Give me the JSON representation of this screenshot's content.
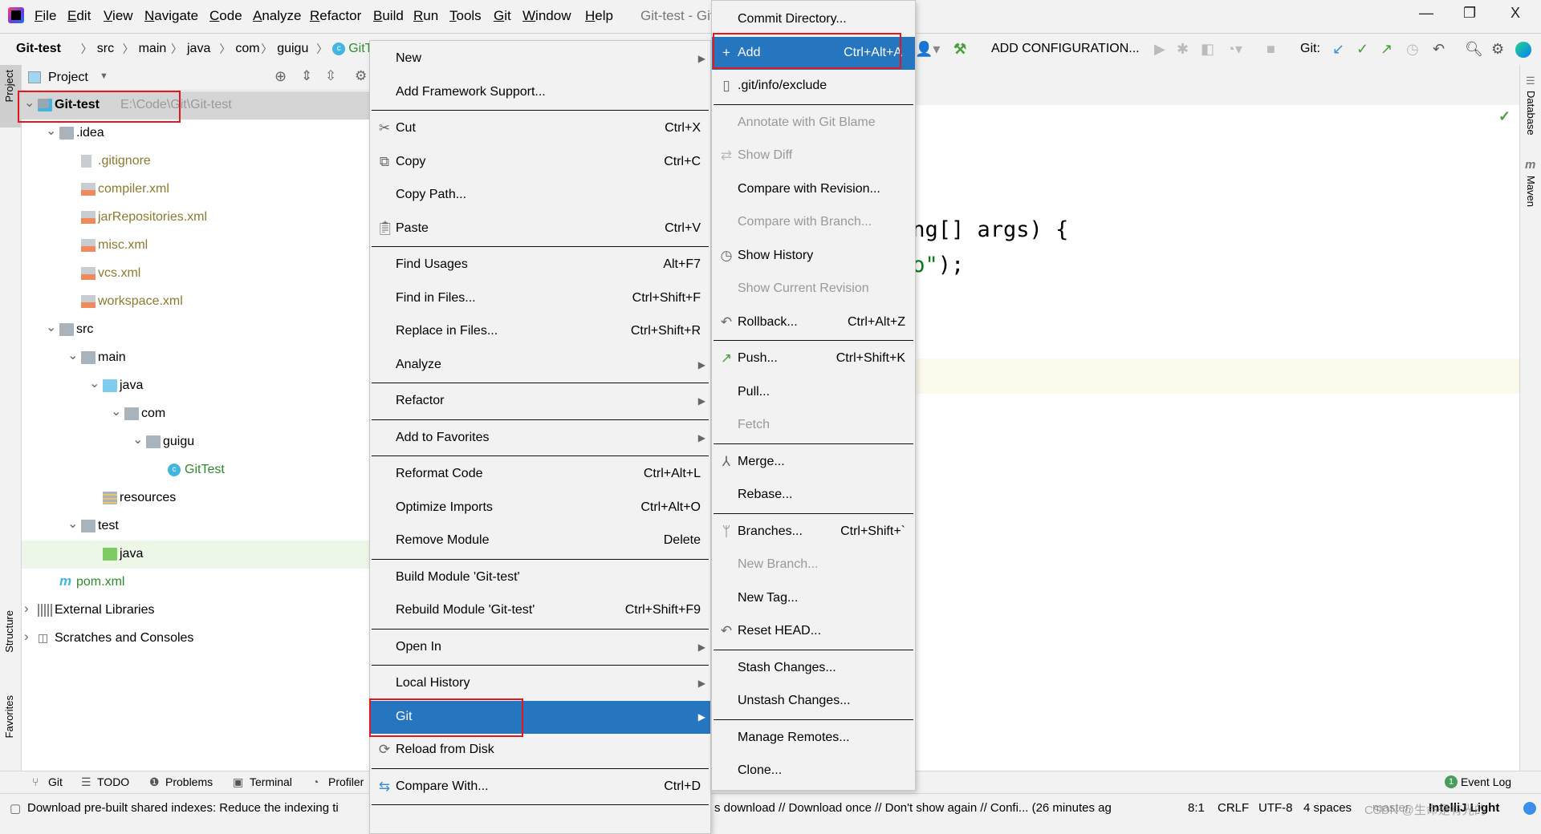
{
  "menubar": {
    "items": [
      "File",
      "Edit",
      "View",
      "Navigate",
      "Code",
      "Analyze",
      "Refactor",
      "Build",
      "Run",
      "Tools",
      "Git",
      "Window",
      "Help"
    ],
    "title": "Git-test - Git"
  },
  "window": {
    "minimize": "—",
    "restore": "❐",
    "close": "X"
  },
  "breadcrumb": [
    "Git-test",
    "src",
    "main",
    "java",
    "com",
    "guigu",
    "GitTest"
  ],
  "toolbar": {
    "add_configuration": "ADD CONFIGURATION...",
    "git_label": "Git:"
  },
  "colors": {
    "accent": "#2675bf",
    "annotation": "#e4161e",
    "untracked": "#8c7a2e",
    "added": "#2e8b2e"
  },
  "project": {
    "header": "Project",
    "rows": [
      {
        "label": "Git-test",
        "suffix": "E:\\Code\\Git\\Git-test",
        "level": 0,
        "expanded": true,
        "icon": "module-folder",
        "bold": true,
        "selected": true
      },
      {
        "label": ".idea",
        "level": 1,
        "expanded": true,
        "icon": "folder"
      },
      {
        "label": ".gitignore",
        "level": 2,
        "icon": "ignored-file",
        "color": "#8c7a2e"
      },
      {
        "label": "compiler.xml",
        "level": 2,
        "icon": "xml-file",
        "color": "#8c7a2e"
      },
      {
        "label": "jarRepositories.xml",
        "level": 2,
        "icon": "xml-file",
        "color": "#8c7a2e"
      },
      {
        "label": "misc.xml",
        "level": 2,
        "icon": "xml-file",
        "color": "#8c7a2e"
      },
      {
        "label": "vcs.xml",
        "level": 2,
        "icon": "xml-file",
        "color": "#8c7a2e"
      },
      {
        "label": "workspace.xml",
        "level": 2,
        "icon": "xml-file",
        "color": "#8c7a2e"
      },
      {
        "label": "src",
        "level": 1,
        "expanded": true,
        "icon": "folder"
      },
      {
        "label": "main",
        "level": 2,
        "expanded": true,
        "icon": "folder"
      },
      {
        "label": "java",
        "level": 3,
        "expanded": true,
        "icon": "source-folder"
      },
      {
        "label": "com",
        "level": 4,
        "expanded": true,
        "icon": "package"
      },
      {
        "label": "guigu",
        "level": 5,
        "expanded": true,
        "icon": "package"
      },
      {
        "label": "GitTest",
        "level": 6,
        "icon": "class",
        "color": "#2e8b2e"
      },
      {
        "label": "resources",
        "level": 3,
        "icon": "resources-folder"
      },
      {
        "label": "test",
        "level": 2,
        "expanded": true,
        "icon": "folder"
      },
      {
        "label": "java",
        "level": 3,
        "icon": "test-folder",
        "highlight": true
      },
      {
        "label": "pom.xml",
        "level": 1,
        "icon": "maven-file",
        "color": "#2e8b2e"
      },
      {
        "label": "External Libraries",
        "level": 0,
        "expanded": false,
        "icon": "libraries"
      },
      {
        "label": "Scratches and Consoles",
        "level": 0,
        "expanded": false,
        "icon": "scratches"
      }
    ]
  },
  "left_strip": {
    "project": "Project",
    "structure": "Structure",
    "favorites": "Favorites"
  },
  "right_strip": {
    "database": "Database",
    "maven": "Maven"
  },
  "editor": {
    "line1": "ing[] args) {",
    "line2_str": "lo\"",
    "line2_rest": ");"
  },
  "context_menu": [
    {
      "label": "New",
      "submenu": true
    },
    {
      "label": "Add Framework Support..."
    },
    {
      "separator": true
    },
    {
      "label": "Cut",
      "shortcut": "Ctrl+X",
      "icon": "scissors"
    },
    {
      "label": "Copy",
      "shortcut": "Ctrl+C",
      "icon": "copy"
    },
    {
      "label": "Copy Path..."
    },
    {
      "label": "Paste",
      "shortcut": "Ctrl+V",
      "icon": "clipboard"
    },
    {
      "separator": true
    },
    {
      "label": "Find Usages",
      "shortcut": "Alt+F7"
    },
    {
      "label": "Find in Files...",
      "shortcut": "Ctrl+Shift+F"
    },
    {
      "label": "Replace in Files...",
      "shortcut": "Ctrl+Shift+R"
    },
    {
      "label": "Analyze",
      "submenu": true
    },
    {
      "separator": true
    },
    {
      "label": "Refactor",
      "submenu": true
    },
    {
      "separator": true
    },
    {
      "label": "Add to Favorites",
      "submenu": true
    },
    {
      "separator": true
    },
    {
      "label": "Reformat Code",
      "shortcut": "Ctrl+Alt+L"
    },
    {
      "label": "Optimize Imports",
      "shortcut": "Ctrl+Alt+O"
    },
    {
      "label": "Remove Module",
      "shortcut": "Delete"
    },
    {
      "separator": true
    },
    {
      "label": "Build Module 'Git-test'"
    },
    {
      "label": "Rebuild Module 'Git-test'",
      "shortcut": "Ctrl+Shift+F9"
    },
    {
      "separator": true
    },
    {
      "label": "Open In",
      "submenu": true
    },
    {
      "separator": true
    },
    {
      "label": "Local History",
      "submenu": true
    },
    {
      "label": "Git",
      "submenu": true,
      "selected": true
    },
    {
      "label": "Reload from Disk",
      "icon": "reload"
    },
    {
      "separator": true
    },
    {
      "label": "Compare With...",
      "shortcut": "Ctrl+D",
      "icon": "compare"
    },
    {
      "separator": true
    }
  ],
  "git_menu": [
    {
      "label": "Commit Directory..."
    },
    {
      "label": "Add",
      "shortcut": "Ctrl+Alt+A",
      "icon": "plus",
      "selected": true
    },
    {
      "label": ".git/info/exclude",
      "icon": "ignored-file"
    },
    {
      "separator": true
    },
    {
      "label": "Annotate with Git Blame",
      "disabled": true
    },
    {
      "label": "Show Diff",
      "disabled": true,
      "icon": "diff"
    },
    {
      "label": "Compare with Revision..."
    },
    {
      "label": "Compare with Branch...",
      "disabled": true
    },
    {
      "label": "Show History",
      "icon": "clock"
    },
    {
      "label": "Show Current Revision",
      "disabled": true
    },
    {
      "label": "Rollback...",
      "shortcut": "Ctrl+Alt+Z",
      "icon": "undo"
    },
    {
      "separator": true
    },
    {
      "label": "Push...",
      "shortcut": "Ctrl+Shift+K",
      "icon": "push-arrow"
    },
    {
      "label": "Pull..."
    },
    {
      "label": "Fetch",
      "disabled": true
    },
    {
      "separator": true
    },
    {
      "label": "Merge...",
      "icon": "merge"
    },
    {
      "label": "Rebase..."
    },
    {
      "separator": true
    },
    {
      "label": "Branches...",
      "shortcut": "Ctrl+Shift+`",
      "icon": "branch"
    },
    {
      "label": "New Branch...",
      "disabled": true
    },
    {
      "label": "New Tag..."
    },
    {
      "label": "Reset HEAD...",
      "icon": "undo"
    },
    {
      "separator": true
    },
    {
      "label": "Stash Changes..."
    },
    {
      "label": "Unstash Changes..."
    },
    {
      "separator": true
    },
    {
      "label": "Manage Remotes..."
    },
    {
      "label": "Clone..."
    }
  ],
  "bottom_tabs": {
    "git": "Git",
    "todo": "TODO",
    "problems": "Problems",
    "terminal": "Terminal",
    "profiler": "Profiler",
    "event_log": "Event Log",
    "event_count": "1"
  },
  "status": {
    "message_left": "Download pre-built shared indexes: Reduce the indexing ti",
    "message_right": "s download // Download once // Don't show again // Confi... (26 minutes ag",
    "position": "8:1",
    "line_sep": "CRLF",
    "encoding": "UTF-8",
    "indent": "4 spaces",
    "branch": "master",
    "theme": "IntelliJ Light",
    "watermark": "CSDN @生命是有光的"
  }
}
